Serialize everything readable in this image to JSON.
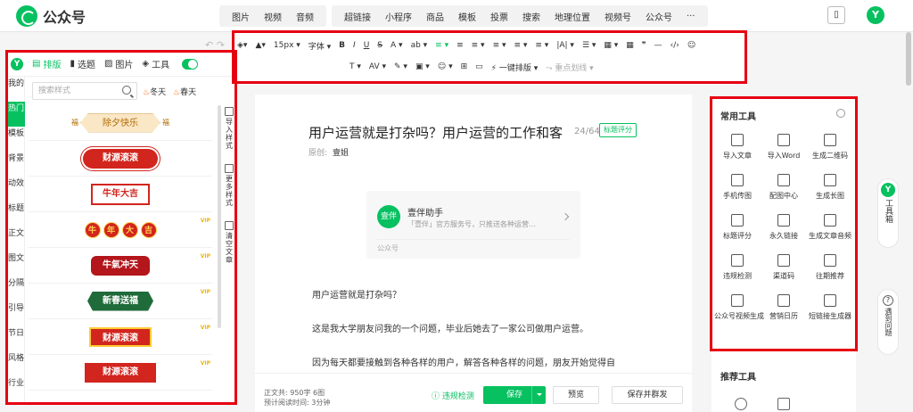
{
  "app": {
    "title": "公众号"
  },
  "top_menu": {
    "group1": [
      "图片",
      "视频",
      "音频"
    ],
    "group2": [
      "超链接",
      "小程序",
      "商品",
      "模板",
      "投票",
      "搜索",
      "地理位置",
      "视频号",
      "公众号",
      "···"
    ]
  },
  "left_panel": {
    "tabs": [
      "排版",
      "选题",
      "图片",
      "工具"
    ],
    "categories": [
      "我的",
      "热门",
      "模板",
      "背景",
      "动效",
      "标题",
      "正文",
      "图文",
      "分隔",
      "引导",
      "节日",
      "风格",
      "行业"
    ],
    "search_placeholder": "搜索样式",
    "season_tags": [
      "冬天",
      "春天"
    ],
    "styles": [
      "除夕快乐",
      "财源滚滚",
      "牛年大吉",
      "牛年大吉",
      "牛氣冲天",
      "新春送福",
      "财源滚滚",
      "财源滚滚"
    ],
    "style4_chars": [
      "牛",
      "年",
      "大",
      "吉"
    ],
    "fu_left": "福",
    "fu_right": "福",
    "vip_label": "VIP",
    "side_tools": [
      "导入样式",
      "更多样式",
      "清空文章"
    ]
  },
  "toolbar": {
    "row1": [
      "◈▾",
      "▲▾",
      "15px ▾",
      "字体 ▾",
      "B",
      "I",
      "U",
      "S",
      "A ▾",
      "ab ▾",
      "≡ ▾",
      "≡",
      "≡ ▾",
      "≡ ▾",
      "≡ ▾",
      "≡ ▾",
      "|A| ▾",
      "☰ ▾",
      "▦ ▾",
      "▦",
      "❞",
      "—",
      "‹/›",
      "☺"
    ],
    "row2": [
      "T ▾",
      "AV ▾",
      "✎ ▾",
      "▣ ▾",
      "☺ ▾",
      "⊞",
      "▭",
      "⚡ 一键排版 ▾",
      "⤳ 重点划线 ▾"
    ]
  },
  "editor": {
    "title": "用户运营就是打杂吗？用户运营的工作和客",
    "char_count": "24/64",
    "title_tag": "标题评分",
    "original_label": "原创:",
    "author": "壹姐",
    "card": {
      "avatar": "壹伴",
      "name": "壹伴助手",
      "desc": "「壹伴」官方服务号，只推送各种运营…",
      "foot": "公众号"
    },
    "paragraphs": [
      "用户运营就是打杂吗？",
      "这是我大学朋友问我的一个问题，毕业后她去了一家公司做用户运营。",
      "因为每天都要接触到各种各样的用户，解答各种各样的问题，朋友开始觉得自"
    ]
  },
  "bottom_bar": {
    "word_count_label": "正文共:",
    "word_count": "950字 6图",
    "read_time_label": "预计阅读时间:",
    "read_time": "3分钟",
    "check": "违规检测",
    "save": "保存",
    "preview": "预览",
    "save_publish": "保存并群发"
  },
  "right_panel": {
    "title": "常用工具",
    "tools": [
      "导入文章",
      "导入Word",
      "生成二维码",
      "手机传图",
      "配图中心",
      "生成长图",
      "标题评分",
      "永久链接",
      "生成文章音频",
      "违规检测",
      "渠道码",
      "往期推荐",
      "公众号视频生成",
      "营销日历",
      "短链接生成器"
    ],
    "icons": [
      "⇩",
      "W",
      "▦",
      "▯",
      "▨",
      "▧",
      "Title",
      "∞",
      "♪",
      "⚡",
      "▦",
      "👍",
      "▶",
      "▤",
      "⛓"
    ],
    "recommended_title": "推荐工具"
  },
  "floats": {
    "tool_box": "工具箱",
    "help": "遇到问题",
    "help_icon": "?"
  },
  "colors": {
    "accent": "#07c160",
    "highlight": "#e60012"
  }
}
